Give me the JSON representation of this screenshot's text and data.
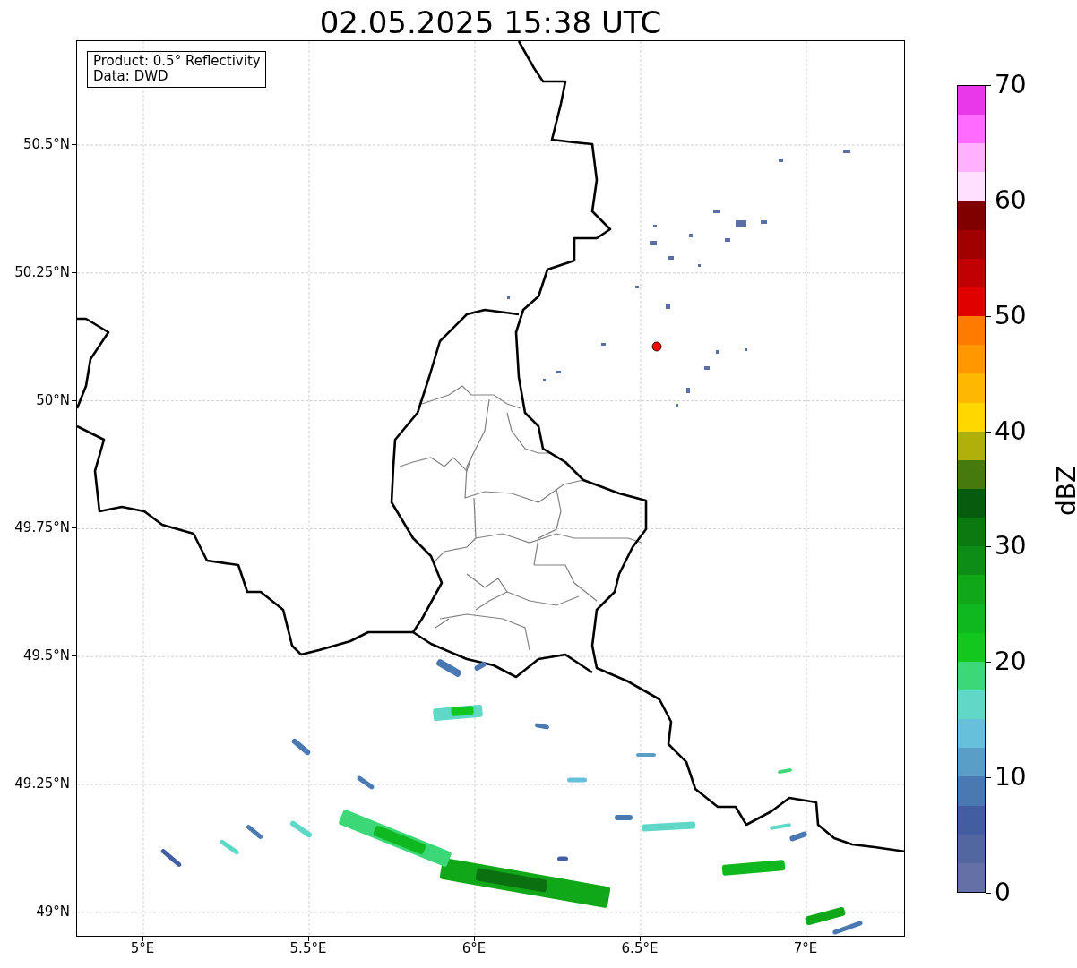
{
  "title": "02.05.2025 15:38 UTC",
  "info_box": [
    "Product: 0.5° Reflectivity",
    "Data: DWD"
  ],
  "map": {
    "x_ticks": [
      "5°E",
      "5.5°E",
      "6°E",
      "6.5°E",
      "7°E"
    ],
    "y_ticks": [
      "50.5°N",
      "50.25°N",
      "50°N",
      "49.75°N",
      "49.5°N",
      "49.25°N",
      "49°N"
    ]
  },
  "colorbar": {
    "label": "dBZ",
    "ticks": [
      "70",
      "60",
      "50",
      "40",
      "30",
      "20",
      "10",
      "0"
    ],
    "segments": [
      {
        "color": "#6470a6"
      },
      {
        "color": "#5266a0"
      },
      {
        "color": "#425ea0"
      },
      {
        "color": "#4a78b0"
      },
      {
        "color": "#5a9ec8"
      },
      {
        "color": "#66c0dc"
      },
      {
        "color": "#60d8c8"
      },
      {
        "color": "#3cd878"
      },
      {
        "color": "#12c81e"
      },
      {
        "color": "#10b820"
      },
      {
        "color": "#10a818"
      },
      {
        "color": "#0e8c18"
      },
      {
        "color": "#0a7a10"
      },
      {
        "color": "#065c0c"
      },
      {
        "color": "#467a0c"
      },
      {
        "color": "#b0b00a"
      },
      {
        "color": "#ffd800"
      },
      {
        "color": "#ffb800"
      },
      {
        "color": "#ff9800"
      },
      {
        "color": "#ff7c00"
      },
      {
        "color": "#e00000"
      },
      {
        "color": "#c00000"
      },
      {
        "color": "#a00000"
      },
      {
        "color": "#800000"
      },
      {
        "color": "#ffe0ff"
      },
      {
        "color": "#ffb0ff"
      },
      {
        "color": "#ff6aff"
      },
      {
        "color": "#e838e8"
      }
    ]
  }
}
